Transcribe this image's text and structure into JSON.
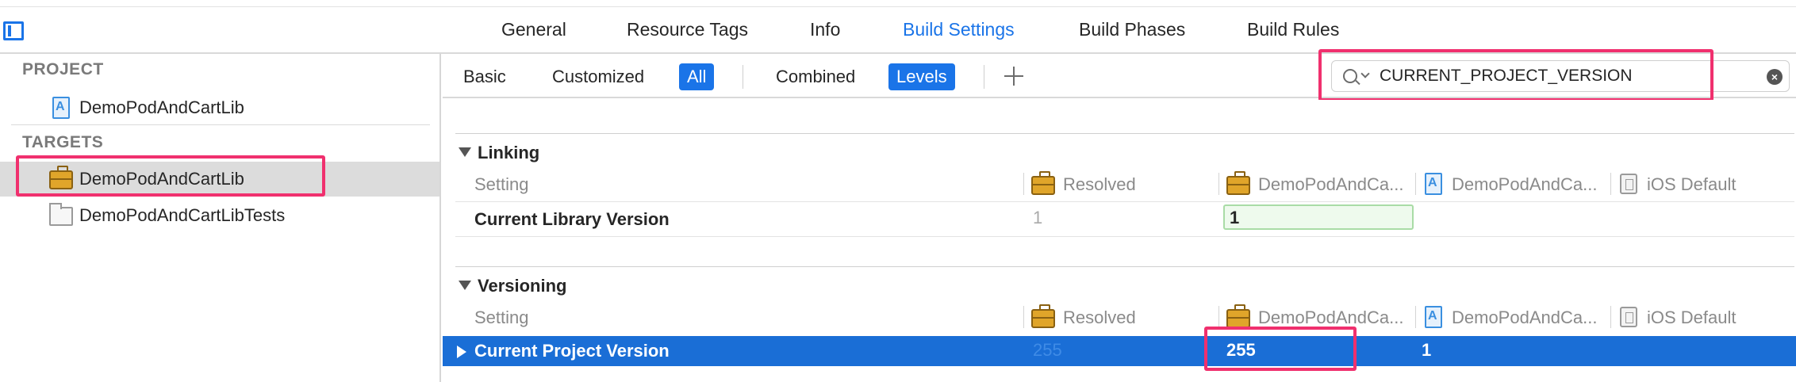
{
  "tabs": [
    "General",
    "Resource Tags",
    "Info",
    "Build Settings",
    "Build Phases",
    "Build Rules"
  ],
  "active_tab": "Build Settings",
  "sidebar": {
    "project_header": "PROJECT",
    "project_item": "DemoPodAndCartLib",
    "targets_header": "TARGETS",
    "target_selected": "DemoPodAndCartLib",
    "target_tests": "DemoPodAndCartLibTests"
  },
  "filter": {
    "basic": "Basic",
    "customized": "Customized",
    "all": "All",
    "combined": "Combined",
    "levels": "Levels",
    "add": "+"
  },
  "search": {
    "value": "CURRENT_PROJECT_VERSION"
  },
  "linking": {
    "title": "Linking",
    "headers": {
      "setting": "Setting",
      "resolved": "Resolved",
      "target": "DemoPodAndCa...",
      "project": "DemoPodAndCa...",
      "default": "iOS Default"
    },
    "row": {
      "name": "Current Library Version",
      "resolved": "1",
      "target": "1"
    }
  },
  "versioning": {
    "title": "Versioning",
    "headers": {
      "setting": "Setting",
      "resolved": "Resolved",
      "target": "DemoPodAndCa...",
      "project": "DemoPodAndCa...",
      "default": "iOS Default"
    },
    "row": {
      "name": "Current Project Version",
      "resolved": "255",
      "target": "255",
      "project": "1"
    }
  },
  "colors": {
    "accent": "#1a74e8",
    "selection": "#1a6ed6",
    "highlight": "#f0306e"
  }
}
